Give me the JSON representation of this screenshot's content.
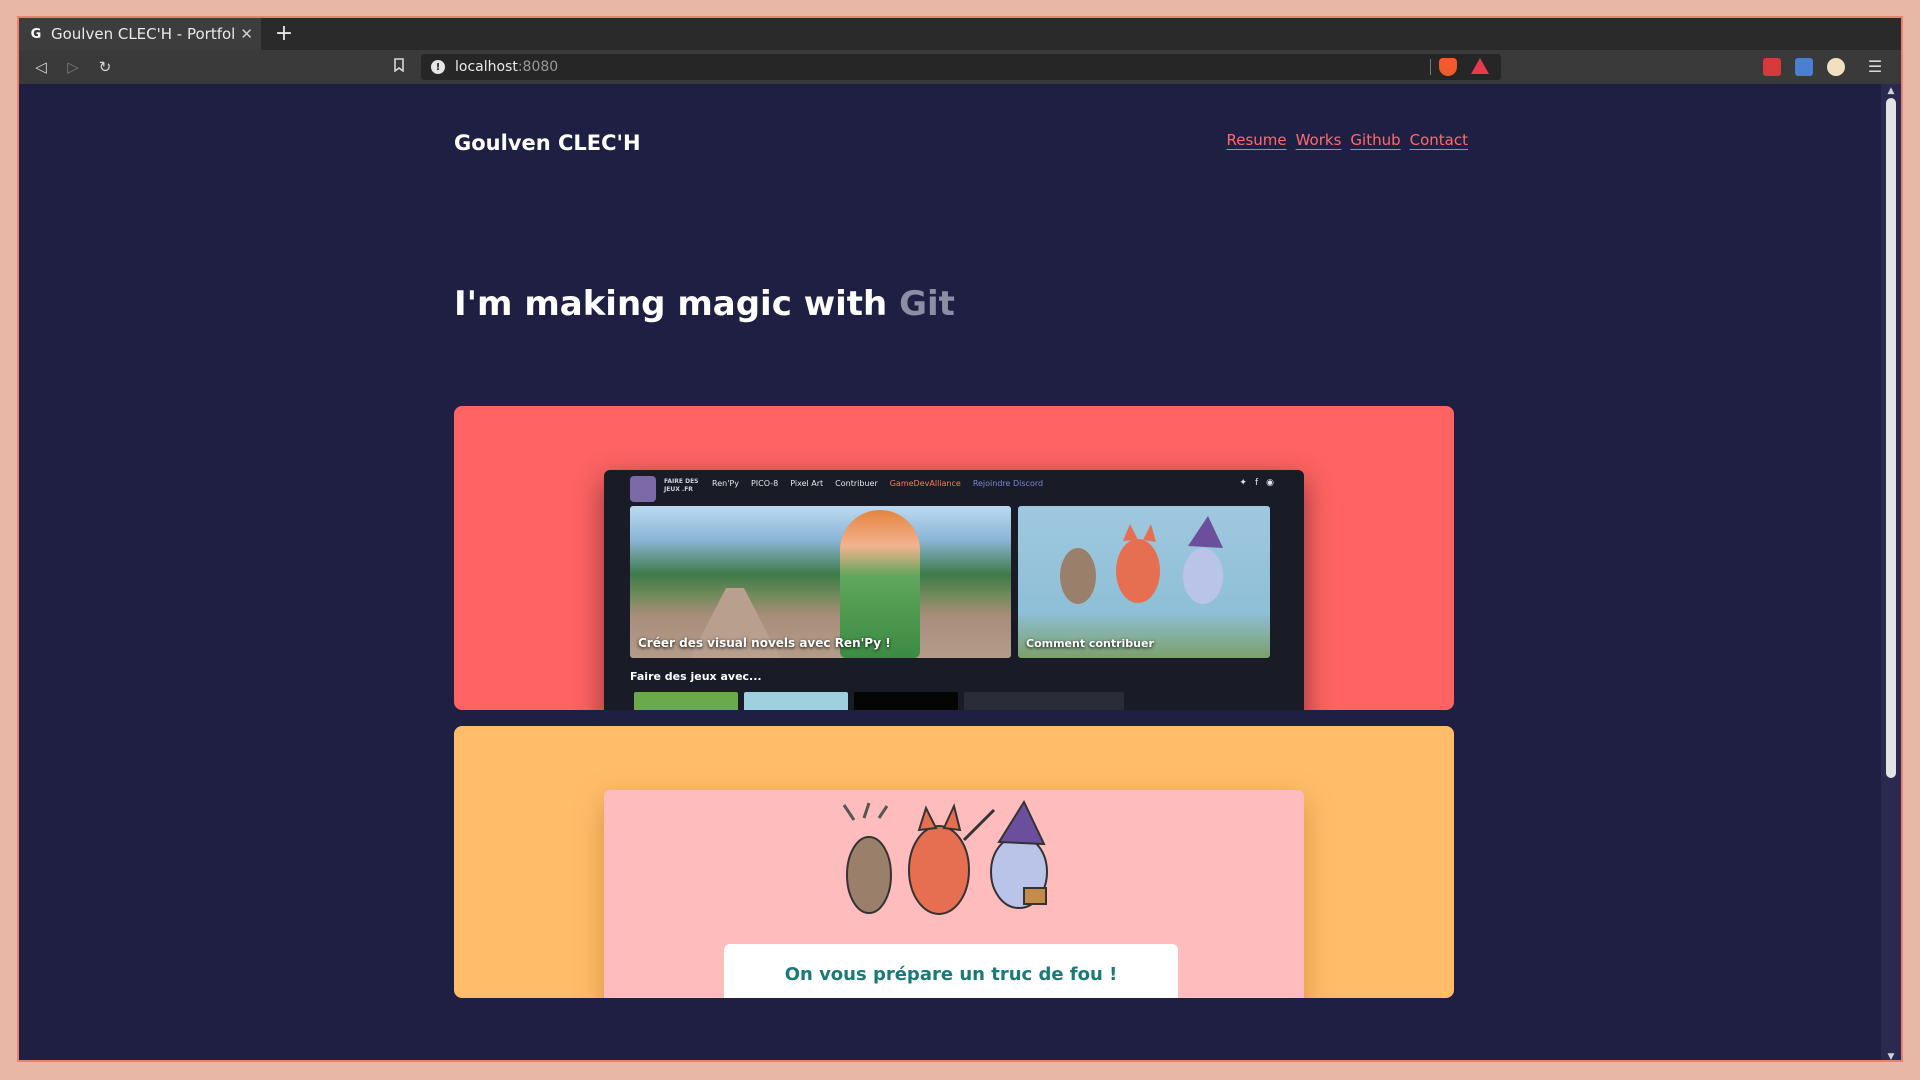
{
  "browser": {
    "tab_title": "Goulven CLEC'H - Portfolio",
    "tab_favicon_letter": "G",
    "new_tab_symbol": "+",
    "close_symbol": "✕",
    "url_host": "localhost",
    "url_port": ":8080"
  },
  "site": {
    "brand": "Goulven CLEC'H",
    "nav": [
      "Resume",
      "Works",
      "Github",
      "Contact"
    ],
    "hero_text": "I'm making magic with ",
    "hero_word": "Git"
  },
  "project1": {
    "logo_text": "FAIRE DES JEUX .FR",
    "menu": [
      "Ren'Py",
      "PICO-8",
      "Pixel Art",
      "Contribuer",
      "GameDevAlliance",
      "Rejoindre Discord"
    ],
    "main_caption": "Créer des visual novels avec Ren'Py !",
    "side_caption": "Comment contribuer",
    "section_title": "Faire des jeux avec..."
  },
  "project2": {
    "message": "On vous prépare un truc de fou !"
  },
  "colors": {
    "background": "#1f1f44",
    "link": "#ff6b6b",
    "card1": "#ff6363",
    "card2": "#ffbd6a"
  }
}
